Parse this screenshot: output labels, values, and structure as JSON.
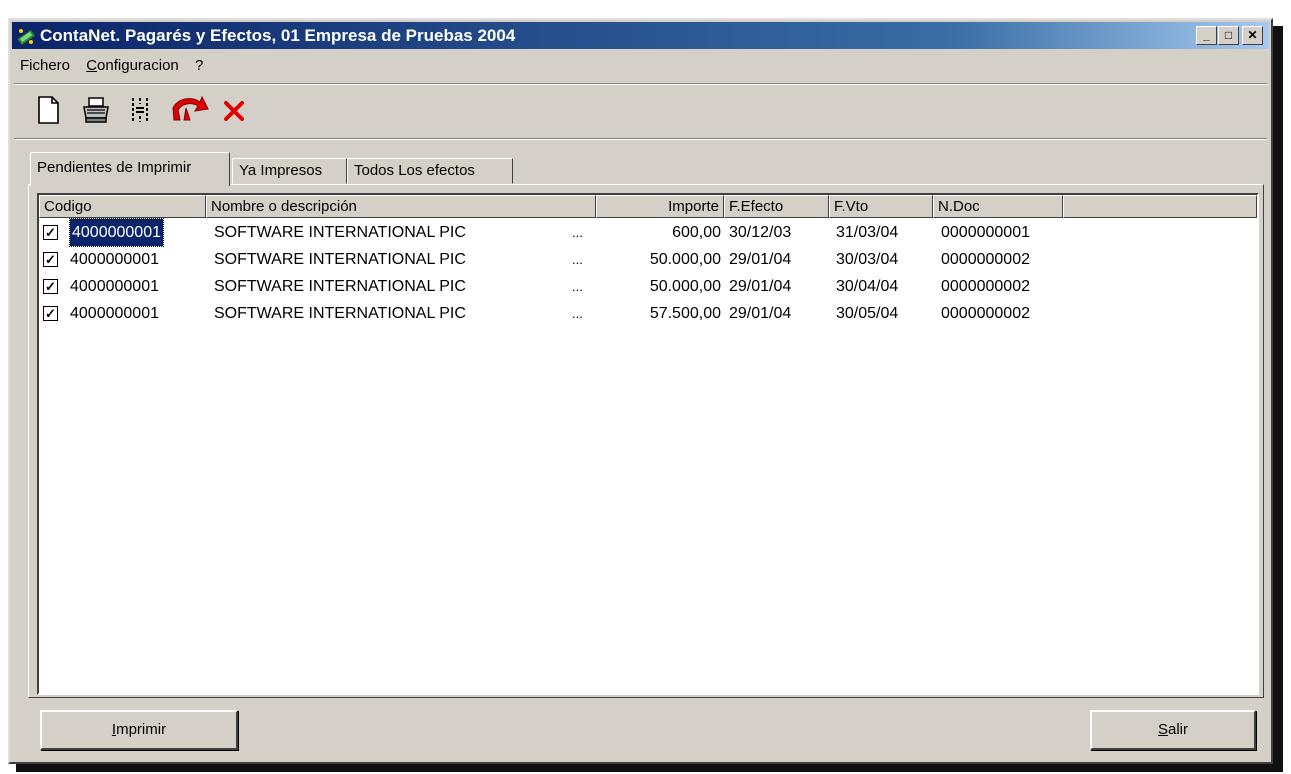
{
  "window": {
    "title": "ContaNet. Pagarés y Efectos, 01 Empresa de Pruebas 2004",
    "min_glyph": "_",
    "max_glyph": "□",
    "close_glyph": "✕"
  },
  "menu": [
    {
      "label": "Fichero",
      "underline": ""
    },
    {
      "label": "onfiguracion",
      "underline": "C"
    },
    {
      "label": "?",
      "underline": ""
    }
  ],
  "toolbar": {
    "icons": [
      "new-document-icon",
      "print-icon",
      "columns-icon",
      "export-arrow-icon",
      "delete-icon"
    ]
  },
  "tabs": [
    {
      "label": "Pendientes de Imprimir",
      "active": true
    },
    {
      "label": "Ya Impresos",
      "active": false
    },
    {
      "label": "Todos Los efectos",
      "active": false
    }
  ],
  "table": {
    "columns": [
      "Codigo",
      "Nombre o descripción",
      "",
      "Importe",
      "F.Efecto",
      "F.Vto",
      "N.Doc",
      ""
    ],
    "rows": [
      {
        "checked": "✓",
        "codigo": "4000000001",
        "nombre": "SOFTWARE INTERNATIONAL PIC",
        "more": "...",
        "importe": "600,00",
        "f_efecto": "30/12/03",
        "f_vto": "31/03/04",
        "n_doc": "0000000001"
      },
      {
        "checked": "✓",
        "codigo": "4000000001",
        "nombre": "SOFTWARE INTERNATIONAL PIC",
        "more": "...",
        "importe": "50.000,00",
        "f_efecto": "29/01/04",
        "f_vto": "30/03/04",
        "n_doc": "0000000002"
      },
      {
        "checked": "✓",
        "codigo": "4000000001",
        "nombre": "SOFTWARE INTERNATIONAL PIC",
        "more": "...",
        "importe": "50.000,00",
        "f_efecto": "29/01/04",
        "f_vto": "30/04/04",
        "n_doc": "0000000002"
      },
      {
        "checked": "✓",
        "codigo": "4000000001",
        "nombre": "SOFTWARE INTERNATIONAL PIC",
        "more": "...",
        "importe": "57.500,00",
        "f_efecto": "29/01/04",
        "f_vto": "30/05/04",
        "n_doc": "0000000002"
      }
    ]
  },
  "buttons": {
    "imprimir_u": "I",
    "imprimir_rest": "mprimir",
    "salir_u": "S",
    "salir_rest": "alir"
  },
  "colors": {
    "titlebar": "#0a246a",
    "face": "#d4d0c8",
    "selection": "#0a246a",
    "accent_red": "#e00000"
  }
}
